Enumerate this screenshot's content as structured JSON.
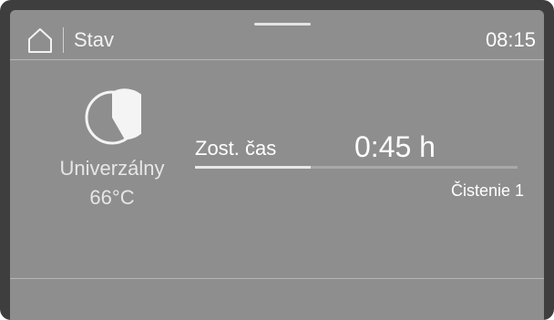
{
  "header": {
    "title": "Stav",
    "clock": "08:15",
    "home_icon": "home-icon"
  },
  "program": {
    "icon": "pie-chart-icon",
    "name": "Univerzálny",
    "temperature": "66°C"
  },
  "remaining": {
    "label": "Zost. čas",
    "value": "0:45 h",
    "progress_percent": 36
  },
  "phase": {
    "label": "Čistenie 1"
  },
  "colors": {
    "screen_bg": "#8e8e8e",
    "frame": "#3e3e3e",
    "text": "#ffffff"
  }
}
